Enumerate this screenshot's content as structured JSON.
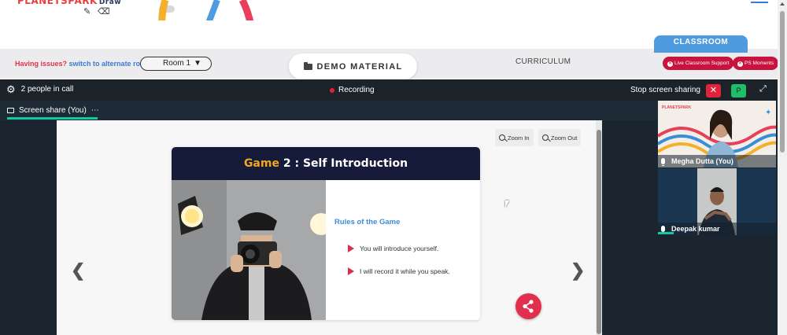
{
  "app": {
    "logo_text": "PLANETSPARK",
    "logo_sub": "Draw"
  },
  "toolbar": {
    "issues_label": "Having issues?",
    "switch_room_link": "switch to alternate room",
    "room_select_value": "Room 1",
    "demo_material_label": "DEMO MATERIAL",
    "curriculum_label": "CURRICULUM",
    "classroom_tab": "CLASSROOM",
    "live_support_label": "Live Classroom Support",
    "ps_moments_label": "PS Moments"
  },
  "call": {
    "people_count": "2 people in call",
    "recording_label": "Recording",
    "stop_sharing_label": "Stop screen sharing",
    "stop_sharing_close": "✕",
    "participant_badge": "P",
    "expand_icon": "⤢",
    "screen_share_tab": "Screen share (You)",
    "more_icon": "⋯"
  },
  "viewer": {
    "zoom_in_label": "Zoom In",
    "zoom_out_label": "Zoom Out",
    "prev_icon": "❮",
    "next_icon": "❯"
  },
  "slide": {
    "title_game": "Game",
    "title_number": "2",
    "title_rest": ": Self Introduction",
    "rules_title": "Rules of the Game",
    "rules": [
      "You will introduce yourself.",
      "I will record it while you speak."
    ]
  },
  "participants": [
    {
      "name": "Megha Dutta (You)"
    },
    {
      "name": "Deepak kumar"
    }
  ],
  "colors": {
    "accent_red": "#e0233a",
    "accent_green": "#14c8a0",
    "call_bar": "#1b2328",
    "slide_header": "#161b3a",
    "game_yellow": "#f4a71d",
    "rules_blue": "#3a8ed6",
    "classroom_blue": "#4f9be0"
  }
}
